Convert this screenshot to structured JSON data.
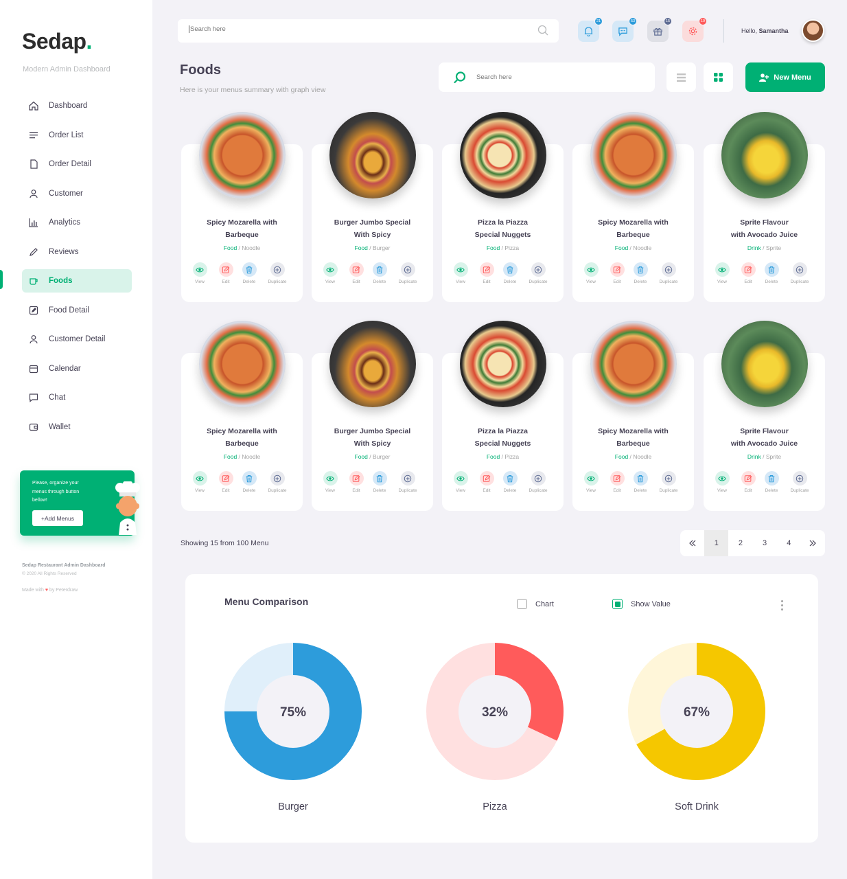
{
  "brand": {
    "name": "Sedap",
    "dot": ".",
    "subtitle": "Modern Admin Dashboard"
  },
  "sidebar": {
    "items": [
      {
        "label": "Dashboard",
        "icon": "home-icon"
      },
      {
        "label": "Order List",
        "icon": "list-icon"
      },
      {
        "label": "Order Detail",
        "icon": "document-icon"
      },
      {
        "label": "Customer",
        "icon": "user-icon"
      },
      {
        "label": "Analytics",
        "icon": "analytics-icon"
      },
      {
        "label": "Reviews",
        "icon": "pencil-icon"
      },
      {
        "label": "Foods",
        "icon": "food-icon",
        "active": true
      },
      {
        "label": "Food Detail",
        "icon": "edit-icon"
      },
      {
        "label": "Customer Detail",
        "icon": "user-icon"
      },
      {
        "label": "Calendar",
        "icon": "calendar-icon"
      },
      {
        "label": "Chat",
        "icon": "chat-icon"
      },
      {
        "label": "Wallet",
        "icon": "wallet-icon"
      }
    ],
    "promo": {
      "text": "Please, organize your menus through button bellow!",
      "button": "+Add Menus"
    },
    "footer": {
      "title": "Sedap Restaurant Admin Dashboard",
      "copyright": "© 2020 All Rights Reserved",
      "made_with": "Made with",
      "by": "by Peterdraw"
    }
  },
  "header": {
    "search_placeholder": "Search here",
    "badges": {
      "notifications": "21",
      "messages": "53",
      "gifts": "15",
      "settings": "19"
    },
    "greeting": "Hello,",
    "user_name": "Samantha"
  },
  "page": {
    "title": "Foods",
    "subtitle": "Here is your menus summary with graph view",
    "search_placeholder": "Search here",
    "new_menu_label": "New Menu"
  },
  "action_labels": {
    "view": "View",
    "edit": "Edit",
    "delete": "Delete",
    "duplicate": "Duplicate"
  },
  "foods": [
    {
      "line1": "Spicy Mozarella with",
      "line2": "Barbeque",
      "cat": "Food",
      "sub": "Noodle",
      "img": "noodle"
    },
    {
      "line1": "Burger Jumbo Special",
      "line2": "With Spicy",
      "cat": "Food",
      "sub": "Burger",
      "img": "burger"
    },
    {
      "line1": "Pizza la Piazza",
      "line2": "Special Nuggets",
      "cat": "Food",
      "sub": "Pizza",
      "img": "pizza"
    },
    {
      "line1": "Spicy Mozarella with",
      "line2": "Barbeque",
      "cat": "Food",
      "sub": "Noodle",
      "img": "noodle"
    },
    {
      "line1": "Sprite Flavour",
      "line2": "with Avocado Juice",
      "cat": "Drink",
      "sub": "Sprite",
      "img": "drink"
    },
    {
      "line1": "Spicy Mozarella with",
      "line2": "Barbeque",
      "cat": "Food",
      "sub": "Noodle",
      "img": "noodle"
    },
    {
      "line1": "Burger Jumbo Special",
      "line2": "With Spicy",
      "cat": "Food",
      "sub": "Burger",
      "img": "burger"
    },
    {
      "line1": "Pizza la Piazza",
      "line2": "Special Nuggets",
      "cat": "Food",
      "sub": "Pizza",
      "img": "pizza"
    },
    {
      "line1": "Spicy Mozarella with",
      "line2": "Barbeque",
      "cat": "Food",
      "sub": "Noodle",
      "img": "noodle"
    },
    {
      "line1": "Sprite Flavour",
      "line2": "with Avocado Juice",
      "cat": "Drink",
      "sub": "Sprite",
      "img": "drink"
    }
  ],
  "pagination": {
    "showing": "Showing 15 from 100 Menu",
    "pages": [
      "1",
      "2",
      "3",
      "4"
    ],
    "current": "1"
  },
  "comparison": {
    "title": "Menu Comparison",
    "chart_label": "Chart",
    "show_value_label": "Show Value",
    "chart_checked": false,
    "show_value_checked": true
  },
  "chart_data": {
    "type": "pie",
    "title": "Menu Comparison",
    "charts": [
      {
        "label": "Burger",
        "value": 75,
        "display": "75%",
        "color": "#2d9cdb",
        "track": "#e0effa"
      },
      {
        "label": "Pizza",
        "value": 32,
        "display": "32%",
        "color": "#ff5b5b",
        "track": "#ffe0e0"
      },
      {
        "label": "Soft Drink",
        "value": 67,
        "display": "67%",
        "color": "#f5c700",
        "track": "#fff6d9"
      }
    ]
  },
  "colors": {
    "primary": "#00b074",
    "blue": "#2d9cdb",
    "red": "#ff5b5b",
    "yellow": "#f5c700"
  }
}
